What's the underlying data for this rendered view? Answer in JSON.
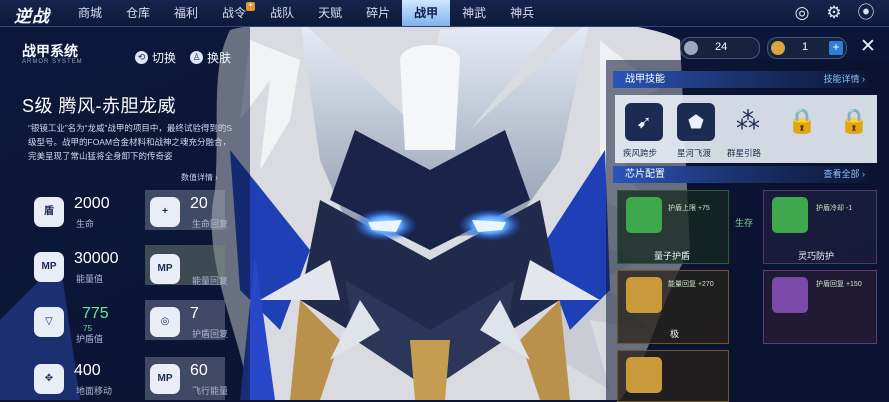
{
  "logo": {
    "title": "逆战",
    "subtitle": ""
  },
  "tabs": [
    {
      "label": "商城",
      "active": false
    },
    {
      "label": "仓库",
      "active": false
    },
    {
      "label": "福利",
      "active": false
    },
    {
      "label": "战令",
      "active": false
    },
    {
      "label": "战队",
      "active": false
    },
    {
      "label": "天赋",
      "active": false
    },
    {
      "label": "碎片",
      "active": false
    },
    {
      "label": "战甲",
      "active": true
    },
    {
      "label": "神武",
      "active": false
    },
    {
      "label": "神兵",
      "active": false
    }
  ],
  "system": {
    "title": "战甲系统",
    "subtitle": "ARMOR SYSTEM",
    "switch_label": "切换",
    "skin_label": "换肤"
  },
  "mech": {
    "name": "S级 腾风-赤胆龙威",
    "description": "“银镜工业”名为“龙威”战甲的项目中，最终试验得到的S级型号。战甲的FOAM合金材料和战神之魂充分融合，完美呈现了常山猛将全身卸下的传奇姿",
    "detail_link": "数值详情 ›"
  },
  "stats": [
    {
      "icon": "盾",
      "value": "2000",
      "label": "生命"
    },
    {
      "icon": "+",
      "value": "20",
      "label": "生命回复"
    },
    {
      "icon": "MP",
      "value": "30000",
      "label": "能量值"
    },
    {
      "icon": "MP",
      "value": "",
      "label": "能量回复"
    },
    {
      "icon": "▽",
      "value": "775",
      "sub": "75",
      "label": "护盾值"
    },
    {
      "icon": "◎",
      "value": "7",
      "label": "护盾回复"
    },
    {
      "icon": "✥",
      "value": "400",
      "label": "地面移动"
    },
    {
      "icon": "MP",
      "value": "60",
      "label": "飞行能量"
    }
  ],
  "resources": {
    "currency_a": "24",
    "currency_b": "1"
  },
  "skills": {
    "header": "战甲技能",
    "more": "技能详情 ›",
    "items": [
      {
        "name": "疾风跨步",
        "icon": "➹",
        "locked": false
      },
      {
        "name": "星河飞渡",
        "icon": "⬟",
        "locked": false
      },
      {
        "name": "群星引路",
        "icon": "⁂",
        "locked": false
      },
      {
        "name": "",
        "icon": "🔒",
        "locked": true
      },
      {
        "name": "",
        "icon": "🔒",
        "locked": true
      }
    ]
  },
  "chips": {
    "header": "芯片配置",
    "more": "查看全部 ›",
    "items": [
      {
        "name": "量子护盾",
        "stat": "护盾上限 +75"
      },
      {
        "name": "生存",
        "stat": ""
      },
      {
        "name": "灵巧防护",
        "stat": "护盾冷却 -1"
      },
      {
        "name": "极",
        "stat": "能量回复 +270"
      },
      {
        "name": "",
        "stat": "护盾回复 +150"
      }
    ]
  },
  "colors": {
    "accent": "#2b55b8",
    "tab_active": "#9fc6f5",
    "stat_green": "#6fe59a",
    "chip_green": "#3fa84c",
    "chip_gold": "#c99a3a",
    "chip_purple": "#7a4aa8"
  },
  "icons": {
    "settings": "gear-icon",
    "spin": "spiral-icon",
    "record": "record-icon",
    "close": "close-icon"
  }
}
